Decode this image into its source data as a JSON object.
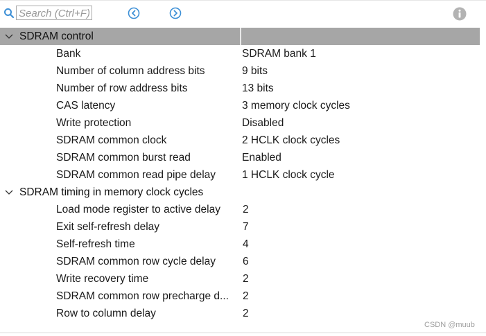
{
  "search": {
    "placeholder": "Search (Ctrl+F)"
  },
  "icons": {
    "search": "search-icon",
    "prev": "arrow-left-circle-icon",
    "next": "arrow-right-circle-icon",
    "info": "info-icon",
    "expand": "chevron-down-icon"
  },
  "colors": {
    "accent": "#3c8fd6",
    "selected_row": "#a6a6a6"
  },
  "sections": [
    {
      "label": "SDRAM control",
      "selected": true,
      "properties": [
        {
          "name": "Bank",
          "value": "SDRAM bank 1"
        },
        {
          "name": "Number of column address bits",
          "value": "9 bits"
        },
        {
          "name": "Number of row address bits",
          "value": "13 bits"
        },
        {
          "name": "CAS latency",
          "value": "3 memory clock cycles"
        },
        {
          "name": "Write protection",
          "value": "Disabled"
        },
        {
          "name": "SDRAM common clock",
          "value": "2 HCLK clock cycles"
        },
        {
          "name": "SDRAM common burst read",
          "value": "Enabled"
        },
        {
          "name": "SDRAM common read pipe delay",
          "value": "1 HCLK clock cycle"
        }
      ]
    },
    {
      "label": "SDRAM timing in memory clock cycles",
      "selected": false,
      "properties": [
        {
          "name": "Load mode register to active delay",
          "value": "2"
        },
        {
          "name": "Exit self-refresh delay",
          "value": "7"
        },
        {
          "name": "Self-refresh time",
          "value": "4"
        },
        {
          "name": "SDRAM common row cycle delay",
          "value": "6"
        },
        {
          "name": "Write recovery time",
          "value": "2"
        },
        {
          "name": "SDRAM common row precharge d...",
          "value": "2"
        },
        {
          "name": "Row to column delay",
          "value": "2"
        }
      ]
    }
  ],
  "watermark": "CSDN @muub"
}
